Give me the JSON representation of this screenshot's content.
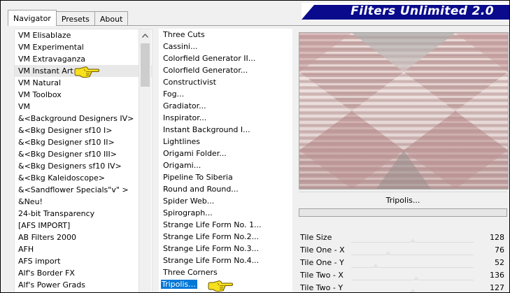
{
  "tabs": [
    {
      "label": "Navigator",
      "active": true
    },
    {
      "label": "Presets",
      "active": false
    },
    {
      "label": "About",
      "active": false
    }
  ],
  "app_title": "Filters Unlimited 2.0",
  "categories": [
    {
      "label": "VM Elisablaze"
    },
    {
      "label": "VM Experimental"
    },
    {
      "label": "VM Extravaganza"
    },
    {
      "label": "VM Instant Art",
      "selected": true
    },
    {
      "label": "VM Natural"
    },
    {
      "label": "VM Toolbox"
    },
    {
      "label": "VM"
    },
    {
      "label": "&<Background Designers IV>"
    },
    {
      "label": "&<Bkg Designer sf10 I>"
    },
    {
      "label": "&<Bkg Designer sf10 II>"
    },
    {
      "label": "&<Bkg Designer sf10 III>"
    },
    {
      "label": "&<Bkg Designers sf10 IV>"
    },
    {
      "label": "&<Bkg Kaleidoscope>"
    },
    {
      "label": "&<Sandflower Specials\"v\" >"
    },
    {
      "label": "&Neu!"
    },
    {
      "label": "24-bit Transparency"
    },
    {
      "label": "[AFS IMPORT]"
    },
    {
      "label": "AB Filters 2000"
    },
    {
      "label": "AFH"
    },
    {
      "label": "AFS import"
    },
    {
      "label": "Alf's Border FX"
    },
    {
      "label": "Alf's Power Grads"
    }
  ],
  "filters": [
    {
      "label": "Three Cuts"
    },
    {
      "label": "Cassini..."
    },
    {
      "label": "Colorfield Generator II..."
    },
    {
      "label": "Colorfield Generator..."
    },
    {
      "label": "Constructivist"
    },
    {
      "label": "Fog..."
    },
    {
      "label": "Gradiator..."
    },
    {
      "label": "Inspirator..."
    },
    {
      "label": "Instant Background I..."
    },
    {
      "label": "Lightlines"
    },
    {
      "label": "Origami Folder..."
    },
    {
      "label": "Origami..."
    },
    {
      "label": "Pipeline To Siberia"
    },
    {
      "label": "Round and Round..."
    },
    {
      "label": "Spider Web..."
    },
    {
      "label": "Spirograph..."
    },
    {
      "label": "Strange Life Form No. 1..."
    },
    {
      "label": "Strange Life Form No.2..."
    },
    {
      "label": "Strange Life Form No.3..."
    },
    {
      "label": "Strange Life Form No.4..."
    },
    {
      "label": "Three Corners"
    },
    {
      "label": "Tripolis...",
      "selected": true
    }
  ],
  "selected_filter_name": "Tripolis...",
  "params": [
    {
      "label": "Tile Size",
      "value": "128",
      "level": 0.5
    },
    {
      "label": "Tile One - X",
      "value": "76",
      "level": 0.3
    },
    {
      "label": "Tile One - Y",
      "value": "52",
      "level": 0.2
    },
    {
      "label": "Tile Two - X",
      "value": "136",
      "level": 0.53
    },
    {
      "label": "Tile Two - Y",
      "value": "127",
      "level": 0.5
    }
  ],
  "icons": {
    "scroll_up": "chevron-up-icon",
    "pointer": "pointing-hand-icon"
  }
}
